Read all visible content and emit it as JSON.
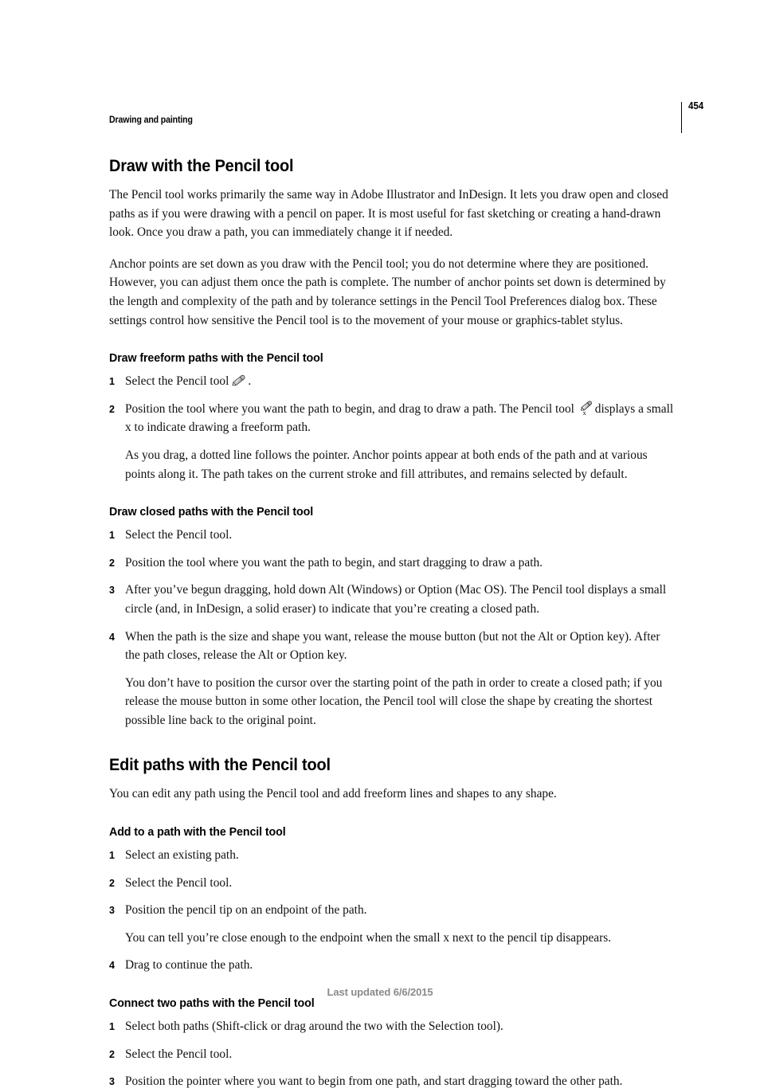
{
  "header": {
    "chapter": "Drawing and painting",
    "page_number": "454"
  },
  "footer": {
    "text": "Last updated 6/6/2015"
  },
  "sections": [
    {
      "title": "Draw with the Pencil tool",
      "paragraphs": [
        "The Pencil tool works primarily the same way in Adobe Illustrator and InDesign. It lets you draw open and closed paths as if you were drawing with a pencil on paper. It is most useful for fast sketching or creating a hand-drawn look. Once you draw a path, you can immediately change it if needed.",
        "Anchor points are set down as you draw with the Pencil tool; you do not determine where they are positioned. However, you can adjust them once the path is complete. The number of anchor points set down is determined by the length and complexity of the path and by tolerance settings in the Pencil Tool Preferences dialog box. These settings control how sensitive the Pencil tool is to the movement of your mouse or graphics-tablet stylus."
      ]
    },
    {
      "title": "Edit paths with the Pencil tool",
      "paragraphs": [
        "You can edit any path using the Pencil tool and add freeform lines and shapes to any shape."
      ]
    }
  ],
  "subsections": {
    "draw_freeform": {
      "title": "Draw freeform paths with the Pencil tool",
      "steps": [
        {
          "num": "1",
          "text_before": "Select the Pencil tool",
          "icon": "pencil-tool-icon",
          "text_after": "."
        },
        {
          "num": "2",
          "text_before": "Position the tool where you want the path to begin, and drag to draw a path. The Pencil tool",
          "icon": "pencil-tool-freeform-x-icon",
          "text_after": "displays a small x to indicate drawing a freeform path.",
          "note": "As you drag, a dotted line follows the pointer. Anchor points appear at both ends of the path and at various points along it. The path takes on the current stroke and fill attributes, and remains selected by default."
        }
      ]
    },
    "draw_closed": {
      "title": "Draw closed paths with the Pencil tool",
      "steps": [
        {
          "num": "1",
          "text": "Select the Pencil tool."
        },
        {
          "num": "2",
          "text": "Position the tool where you want the path to begin, and start dragging to draw a path."
        },
        {
          "num": "3",
          "text": "After you’ve begun dragging, hold down Alt (Windows) or Option (Mac OS). The Pencil tool displays a small circle (and, in InDesign, a solid eraser) to indicate that you’re creating a closed path."
        },
        {
          "num": "4",
          "text": "When the path is the size and shape you want, release the mouse button (but not the Alt or Option key). After the path closes, release the Alt or Option key.",
          "note": "You don’t have to position the cursor over the starting point of the path in order to create a closed path; if you release the mouse button in some other location, the Pencil tool will close the shape by creating the shortest possible line back to the original point."
        }
      ]
    },
    "add_to_path": {
      "title": "Add to a path with the Pencil tool",
      "steps": [
        {
          "num": "1",
          "text": "Select an existing path."
        },
        {
          "num": "2",
          "text": "Select the Pencil tool."
        },
        {
          "num": "3",
          "text": "Position the pencil tip on an endpoint of the path.",
          "note": "You can tell you’re close enough to the endpoint when the small x next to the pencil tip disappears."
        },
        {
          "num": "4",
          "text": "Drag to continue the path."
        }
      ]
    },
    "connect_two": {
      "title": "Connect two paths with the Pencil tool",
      "steps": [
        {
          "num": "1",
          "text": "Select both paths (Shift-click or drag around the two with the Selection tool)."
        },
        {
          "num": "2",
          "text": "Select the Pencil tool."
        },
        {
          "num": "3",
          "text": "Position the pointer where you want to begin from one path, and start dragging toward the other path."
        }
      ]
    }
  },
  "colors": {
    "text": "#111111",
    "footer_text": "#8a8a8a",
    "rule": "#000000",
    "background": "#ffffff"
  }
}
